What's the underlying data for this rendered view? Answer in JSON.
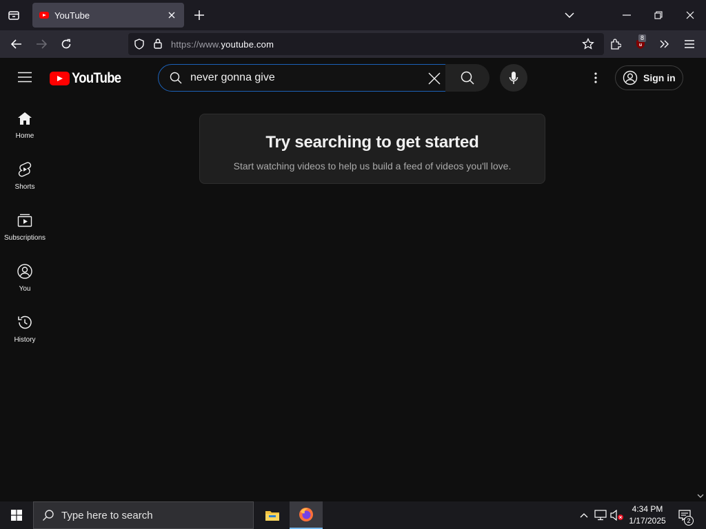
{
  "browser": {
    "tab_title": "YouTube",
    "url_prefix": "https://www.",
    "url_domain": "youtube.com",
    "extension_badge": "8"
  },
  "header": {
    "logo_text": "YouTube",
    "search_value": "never gonna give ",
    "signin_label": "Sign in"
  },
  "sidebar": {
    "items": [
      {
        "label": "Home",
        "icon": "home-icon"
      },
      {
        "label": "Shorts",
        "icon": "shorts-icon"
      },
      {
        "label": "Subscriptions",
        "icon": "subscriptions-icon"
      },
      {
        "label": "You",
        "icon": "you-icon"
      },
      {
        "label": "History",
        "icon": "history-icon"
      }
    ]
  },
  "main": {
    "empty_title": "Try searching to get started",
    "empty_subtitle": "Start watching videos to help us build a feed of videos you'll love."
  },
  "taskbar": {
    "search_placeholder": "Type here to search",
    "time": "4:34 PM",
    "date": "1/17/2025",
    "notification_count": "2"
  },
  "colors": {
    "background": "#0f0f0f",
    "youtube_red": "#ff0000",
    "search_focus_border": "#1c62b9"
  }
}
